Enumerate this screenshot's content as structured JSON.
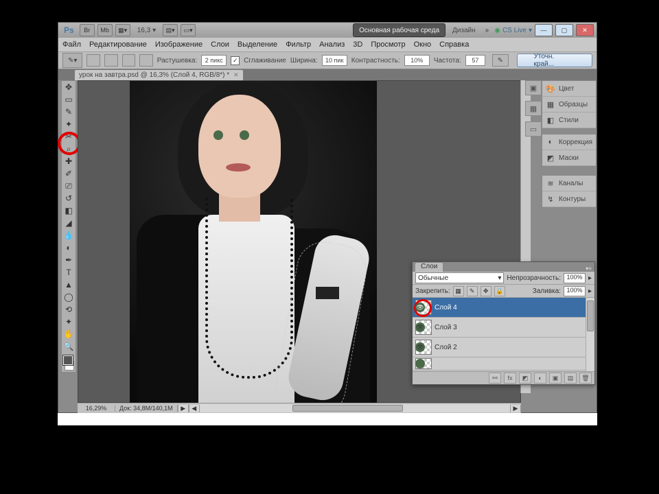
{
  "titlebar": {
    "br_label": "Br",
    "mb_label": "Mb",
    "zoom_display": "16,3",
    "workspace_btn": "Основная рабочая среда",
    "design_label": "Дизайн",
    "cs_live": "CS Live"
  },
  "menu": {
    "file": "Файл",
    "edit": "Редактирование",
    "image": "Изображение",
    "layer": "Слои",
    "select": "Выделение",
    "filter": "Фильтр",
    "analysis": "Анализ",
    "threeD": "3D",
    "view": "Просмотр",
    "window": "Окно",
    "help": "Справка"
  },
  "options": {
    "feather_label": "Растушевка:",
    "feather_value": "2 пикс",
    "antialias_label": "Сглаживание",
    "width_label": "Ширина:",
    "width_value": "10 пик",
    "contrast_label": "Контрастность:",
    "contrast_value": "10%",
    "frequency_label": "Частота:",
    "frequency_value": "57",
    "refine_btn": "Уточн. край..."
  },
  "document": {
    "tab_title": "урок на завтра.psd @ 16,3% (Слой 4, RGB/8*) *",
    "zoom_status": "16,29%",
    "doc_info": "Док: 34,8M/140,1M"
  },
  "right_panels": {
    "color": "Цвет",
    "swatches": "Образцы",
    "styles": "Стили",
    "adjustments": "Коррекция",
    "masks": "Маски",
    "channels": "Каналы",
    "paths": "Контуры"
  },
  "layers_panel": {
    "tab": "Слои",
    "blend_mode": "Обычные",
    "opacity_label": "Непрозрачность:",
    "opacity_value": "100%",
    "lock_label": "Закрепить:",
    "fill_label": "Заливка:",
    "fill_value": "100%",
    "layers": [
      {
        "name": "Слой 4",
        "selected": true
      },
      {
        "name": "Слой 3",
        "selected": false
      },
      {
        "name": "Слой 2",
        "selected": false
      }
    ]
  }
}
